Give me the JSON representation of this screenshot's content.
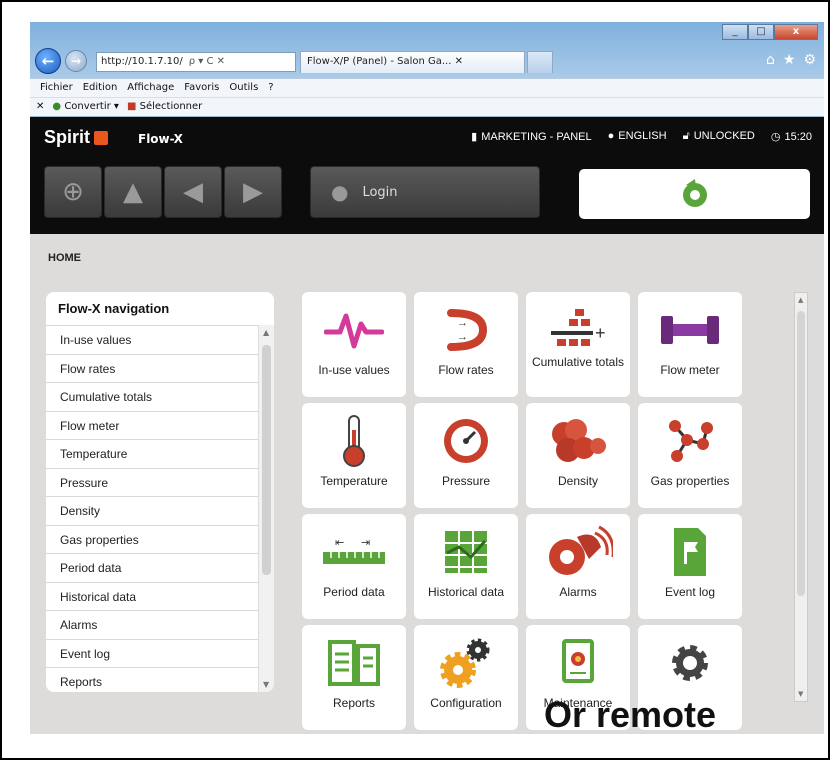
{
  "browser": {
    "address": "http://10.1.7.10/",
    "address_controls": "ρ ▾ C ✕",
    "tab_title": "Flow-X/P (Panel) - Salon Ga...",
    "tab_close": "✕",
    "menu": [
      "Fichier",
      "Edition",
      "Affichage",
      "Favoris",
      "Outils",
      "?"
    ],
    "cmd_close": "✕",
    "cmd_convert": "Convertir",
    "cmd_select": "Sélectionner"
  },
  "header": {
    "logo": "Spirit",
    "product": "Flow-X",
    "panel": "MARKETING - PANEL",
    "language": "ENGLISH",
    "lock": "UNLOCKED",
    "time": "15:20",
    "login_label": "Login"
  },
  "breadcrumb": "HOME",
  "sidebar": {
    "title": "Flow-X navigation",
    "items": [
      "In-use values",
      "Flow rates",
      "Cumulative totals",
      "Flow meter",
      "Temperature",
      "Pressure",
      "Density",
      "Gas properties",
      "Period data",
      "Historical data",
      "Alarms",
      "Event log",
      "Reports"
    ]
  },
  "tiles": [
    {
      "label": "In-use values",
      "icon": "heartbeat-icon"
    },
    {
      "label": "Flow rates",
      "icon": "flow-rates-icon"
    },
    {
      "label": "Cumulative totals",
      "icon": "cumulative-totals-icon"
    },
    {
      "label": "Flow meter",
      "icon": "flow-meter-icon"
    },
    {
      "label": "Temperature",
      "icon": "thermometer-icon"
    },
    {
      "label": "Pressure",
      "icon": "gauge-icon"
    },
    {
      "label": "Density",
      "icon": "density-icon"
    },
    {
      "label": "Gas properties",
      "icon": "molecule-icon"
    },
    {
      "label": "Period data",
      "icon": "ruler-icon"
    },
    {
      "label": "Historical data",
      "icon": "historical-data-icon"
    },
    {
      "label": "Alarms",
      "icon": "alarm-icon"
    },
    {
      "label": "Event log",
      "icon": "event-log-icon"
    },
    {
      "label": "Reports",
      "icon": "reports-icon"
    },
    {
      "label": "Configuration",
      "icon": "configuration-icon"
    },
    {
      "label": "Maintenance",
      "icon": "certificate-icon"
    },
    {
      "label": "",
      "icon": "settings-gear-icon"
    }
  ],
  "overlay_text": "Or remote",
  "colors": {
    "accent_green": "#5aa53a",
    "accent_red": "#c8402c",
    "magenta": "#d43a9a",
    "header_bg": "#0c0c0c"
  }
}
